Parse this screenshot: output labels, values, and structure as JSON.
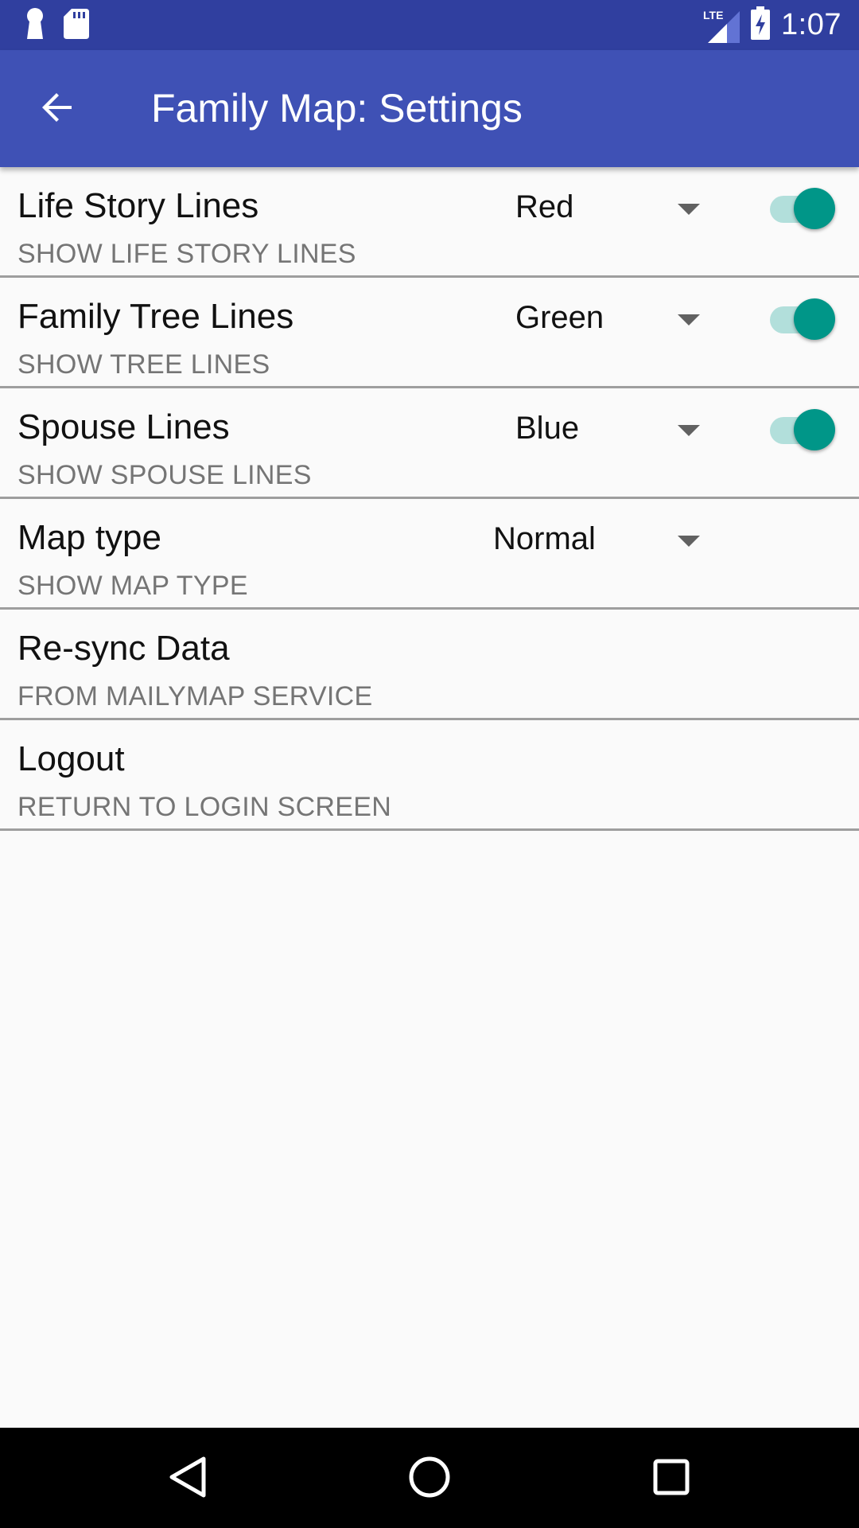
{
  "status_bar": {
    "network_label": "LTE",
    "time": "1:07",
    "icons": [
      "keyhole-icon",
      "sd-card-icon",
      "lte-signal-icon",
      "battery-charging-icon"
    ]
  },
  "app_bar": {
    "title": "Family Map: Settings",
    "back_icon": "arrow-back-icon",
    "background": "#3f51b5",
    "status_background": "#303f9f"
  },
  "settings": {
    "life_story_lines": {
      "title": "Life Story Lines",
      "subtitle": "SHOW LIFE STORY LINES",
      "selected_color": "Red",
      "enabled": true
    },
    "family_tree_lines": {
      "title": "Family Tree Lines",
      "subtitle": "SHOW TREE LINES",
      "selected_color": "Green",
      "enabled": true
    },
    "spouse_lines": {
      "title": "Spouse Lines",
      "subtitle": "SHOW SPOUSE LINES",
      "selected_color": "Blue",
      "enabled": true
    },
    "map_type": {
      "title": "Map type",
      "subtitle": "SHOW MAP TYPE",
      "selected_value": "Normal"
    },
    "resync": {
      "title": "Re-sync Data",
      "subtitle": "FROM MAILYMAP SERVICE"
    },
    "logout": {
      "title": "Logout",
      "subtitle": "RETURN TO LOGIN SCREEN"
    }
  },
  "colors": {
    "toggle_on_thumb": "#009688",
    "toggle_on_track": "#b2dfdb",
    "divider": "#9e9e9e"
  },
  "nav_bar": {
    "icons": [
      "back-triangle-icon",
      "home-circle-icon",
      "recents-square-icon"
    ]
  }
}
